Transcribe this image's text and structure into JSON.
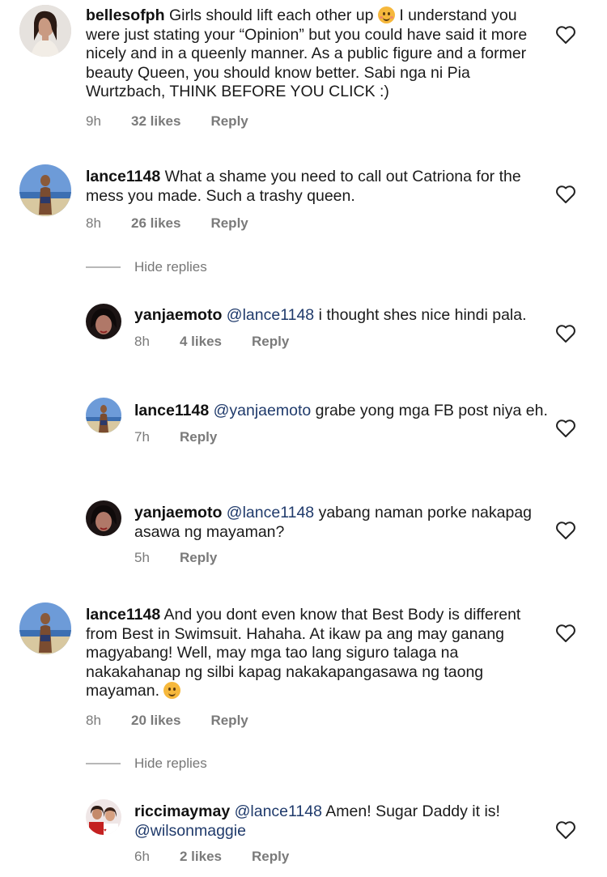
{
  "comments": [
    {
      "user": "bellesofph",
      "text_before_emoji": "Girls should lift each other up",
      "emoji": "smiling-face-emoji",
      "text_after_emoji": "I understand you were just stating your “Opinion” but you could have said it more nicely and in a queenly manner. As a public figure and a former beauty Queen, you should know better. Sabi nga ni Pia Wurtzbach, THINK BEFORE YOU CLICK :)",
      "time": "9h",
      "likes": "32 likes",
      "reply": "Reply"
    },
    {
      "user": "lance1148",
      "text": "What a shame you need to call out Catriona for the mess you made. Such a trashy queen.",
      "time": "8h",
      "likes": "26 likes",
      "reply": "Reply",
      "hide_replies": "Hide replies",
      "replies": [
        {
          "user": "yanjaemoto",
          "mention": "@lance1148",
          "text": "i thought shes nice hindi pala.",
          "time": "8h",
          "likes": "4 likes",
          "reply": "Reply"
        },
        {
          "user": "lance1148",
          "mention": "@yanjaemoto",
          "text": "grabe yong mga FB post niya eh.",
          "time": "7h",
          "reply": "Reply"
        },
        {
          "user": "yanjaemoto",
          "mention": "@lance1148",
          "text": "yabang naman porke nakapag asawa ng mayaman?",
          "time": "5h",
          "reply": "Reply"
        }
      ]
    },
    {
      "user": "lance1148",
      "text": "And you dont even know that Best Body is different from Best in Swimsuit. Hahaha. At ikaw pa ang may ganang magyabang! Well, may mga tao lang siguro talaga na nakakahanap ng silbi kapag nakakapangasawa ng taong mayaman.",
      "emoji": "smiling-face-emoji",
      "time": "8h",
      "likes": "20 likes",
      "reply": "Reply",
      "hide_replies": "Hide replies",
      "replies": [
        {
          "user": "riccimaymay",
          "mention": "@lance1148",
          "text": "Amen! Sugar Daddy it is!",
          "mention2": "@wilsonmaggie",
          "time": "6h",
          "likes": "2 likes",
          "reply": "Reply"
        }
      ]
    }
  ],
  "icons": {
    "like": "heart-outline-icon"
  }
}
